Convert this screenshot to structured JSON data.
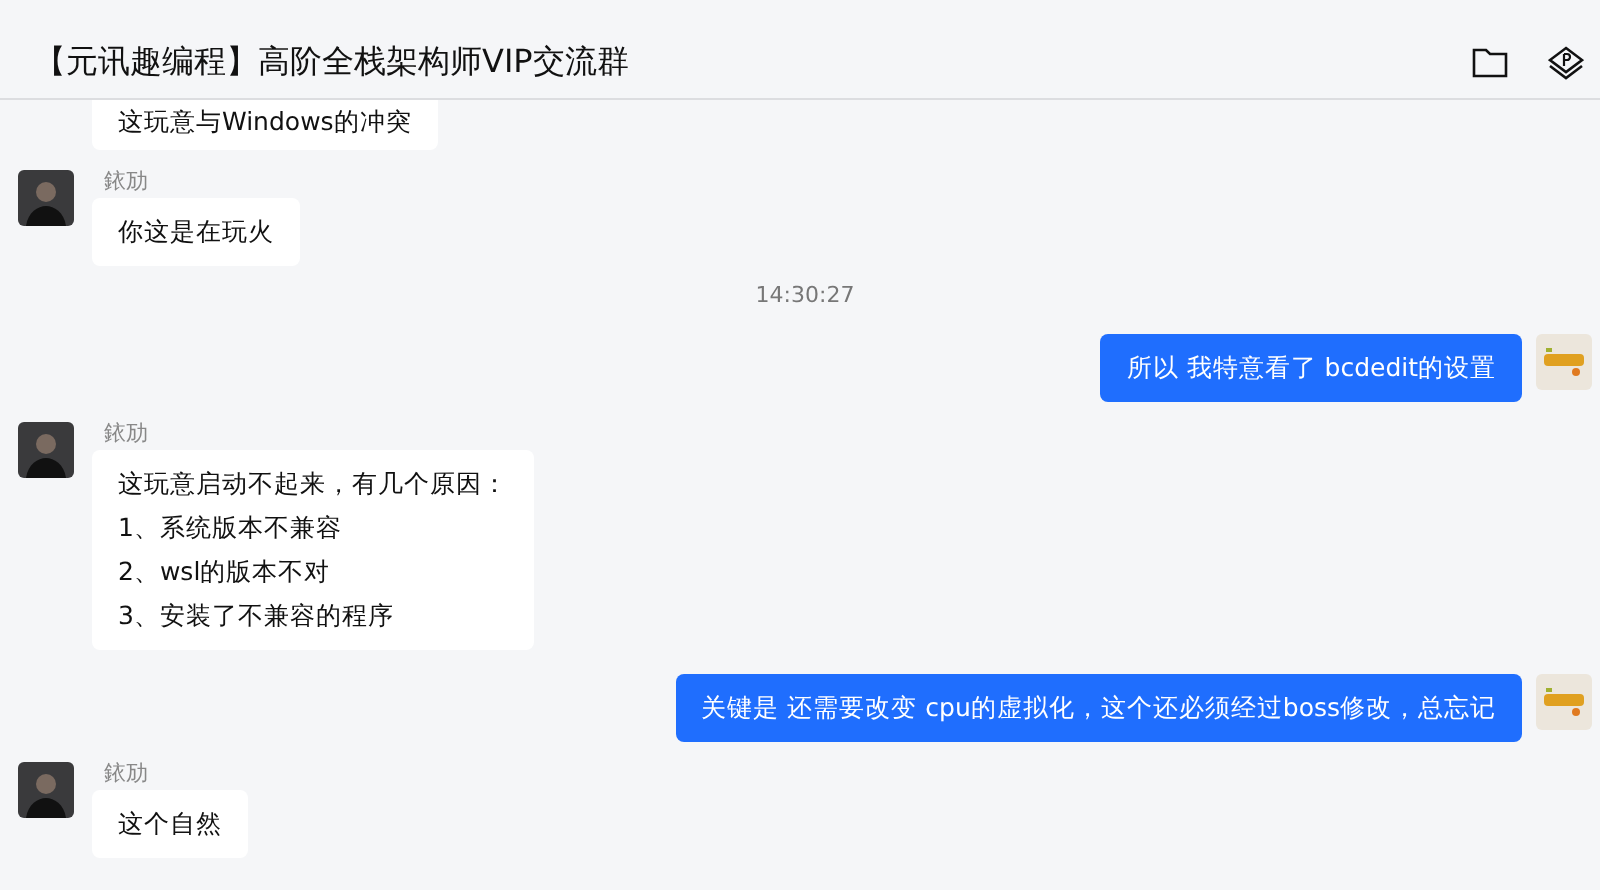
{
  "header": {
    "title": "【元讯趣编程】高阶全栈架构师VIP交流群"
  },
  "messages": [
    {
      "kind": "incoming",
      "lines": [
        "这玩意与Windows的冲突"
      ]
    },
    {
      "kind": "incoming",
      "sender": "銥劢",
      "lines": [
        "你这是在玩火"
      ]
    },
    {
      "kind": "time",
      "text": "14:30:27"
    },
    {
      "kind": "outgoing",
      "lines": [
        "所以  我特意看了  bcdedit的设置"
      ]
    },
    {
      "kind": "incoming",
      "sender": "銥劢",
      "lines": [
        "这玩意启动不起来，有几个原因：",
        "1、系统版本不兼容",
        "2、wsl的版本不对",
        "3、安装了不兼容的程序"
      ]
    },
    {
      "kind": "outgoing",
      "lines": [
        "关键是 还需要改变 cpu的虚拟化，这个还必须经过boss修改，总忘记"
      ]
    },
    {
      "kind": "incoming",
      "sender": "銥劢",
      "lines": [
        "这个自然"
      ]
    }
  ]
}
